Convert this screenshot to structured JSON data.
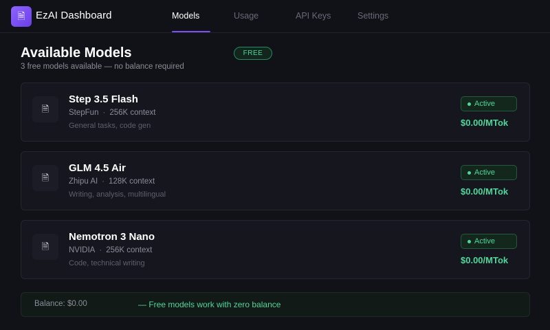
{
  "app": {
    "title": "EzAI Dashboard",
    "logo_icon": "document-icon"
  },
  "nav": {
    "tabs": [
      {
        "label": "Models",
        "active": true
      },
      {
        "label": "Usage",
        "active": false
      },
      {
        "label": "API Keys",
        "active": false
      },
      {
        "label": "Settings",
        "active": false
      }
    ]
  },
  "header": {
    "title": "Available Models",
    "subtitle": "3 free models available — no balance required",
    "badge": "FREE"
  },
  "models": [
    {
      "name": "Step 3.5 Flash",
      "provider": "StepFun",
      "context": "256K context",
      "tags": "General tasks, code gen",
      "status": "Active",
      "price": "$0.00/MTok",
      "icon": "model-icon"
    },
    {
      "name": "GLM 4.5 Air",
      "provider": "Zhipu AI",
      "context": "128K context",
      "tags": "Writing, analysis, multilingual",
      "status": "Active",
      "price": "$0.00/MTok",
      "icon": "model-icon"
    },
    {
      "name": "Nemotron 3 Nano",
      "provider": "NVIDIA",
      "context": "256K context",
      "tags": "Code, technical writing",
      "status": "Active",
      "price": "$0.00/MTok",
      "icon": "model-icon"
    }
  ],
  "footer": {
    "balance": "Balance: $0.00",
    "note": "— Free models work with zero balance"
  },
  "colors": {
    "accent": "#7a52f4",
    "success": "#4fd79a",
    "background": "#111118",
    "card": "#16161f"
  }
}
